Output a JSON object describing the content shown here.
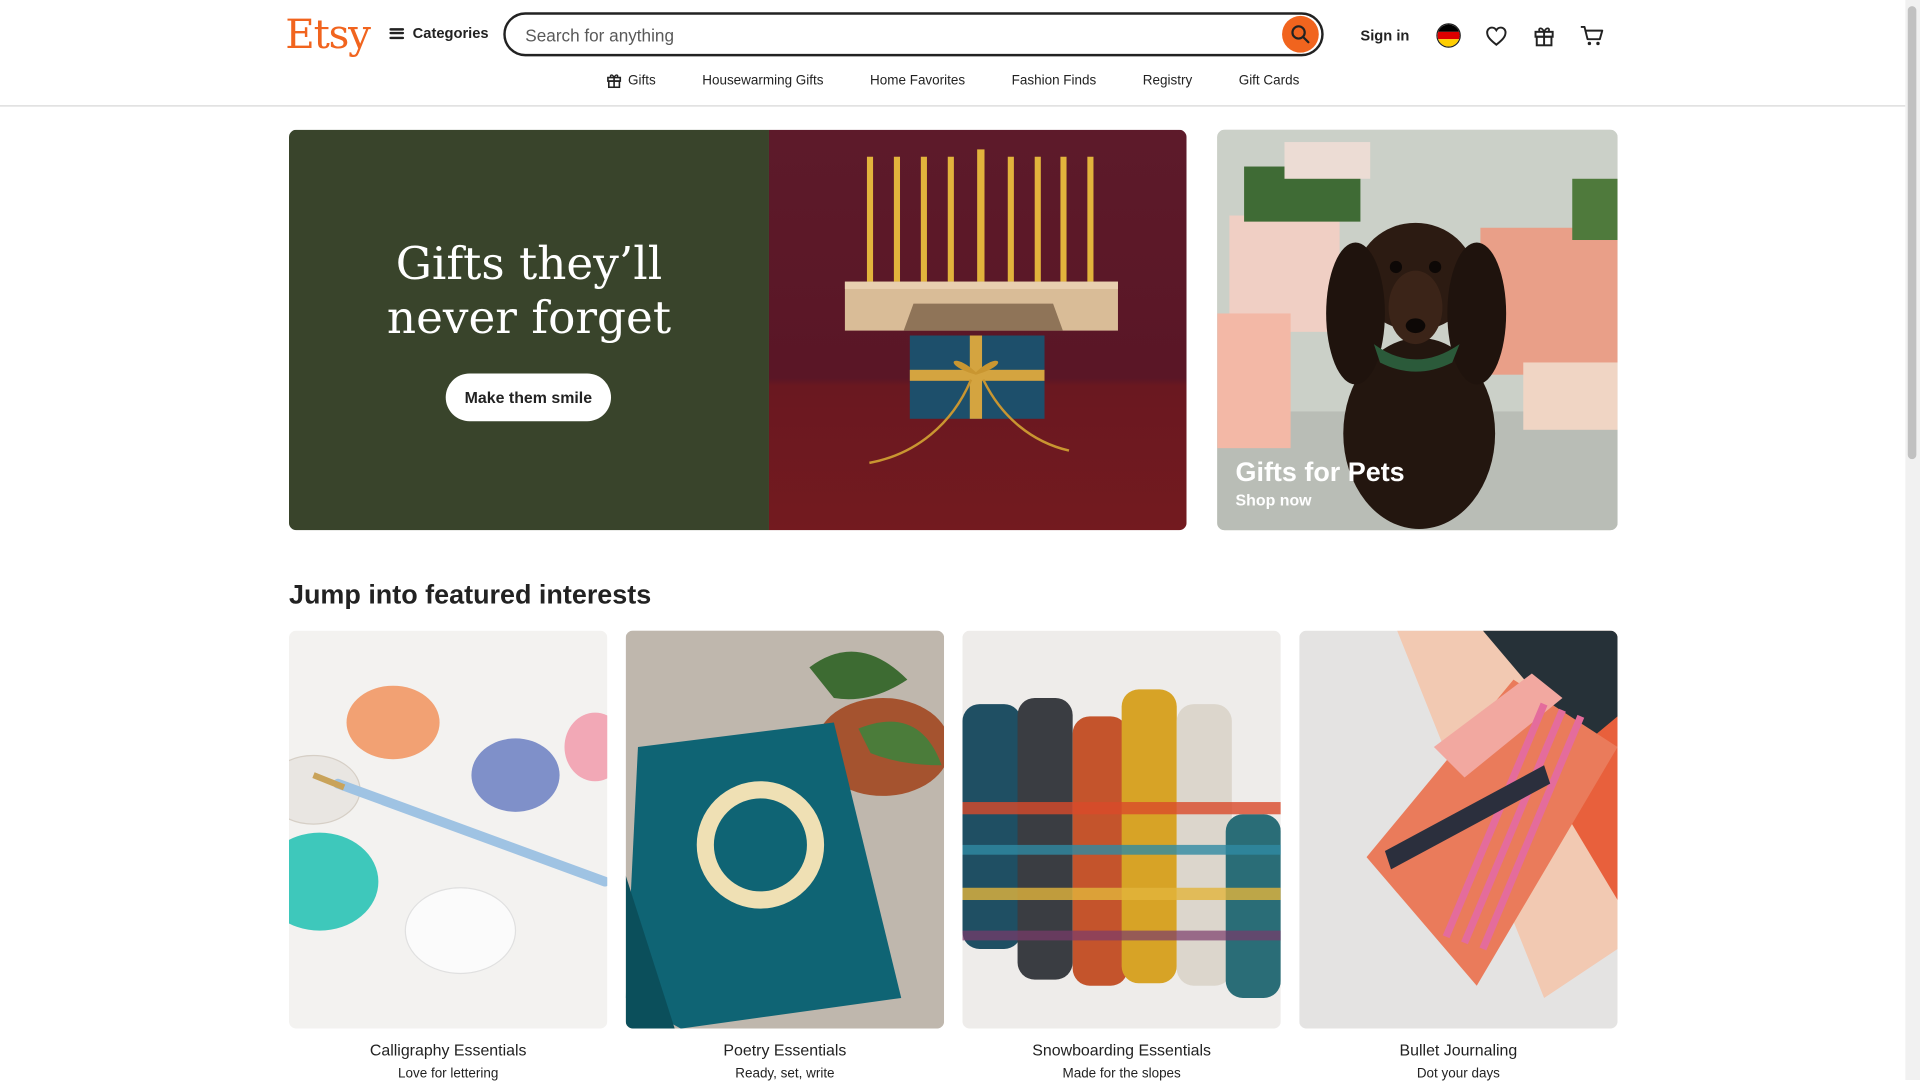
{
  "header": {
    "logo": "Etsy",
    "categories_label": "Categories",
    "search_placeholder": "Search for anything",
    "sign_in": "Sign in"
  },
  "subnav": {
    "items": [
      {
        "label": "Gifts",
        "icon": "gift-icon"
      },
      {
        "label": "Housewarming Gifts"
      },
      {
        "label": "Home Favorites"
      },
      {
        "label": "Fashion Finds"
      },
      {
        "label": "Registry"
      },
      {
        "label": "Gift Cards"
      }
    ]
  },
  "hero": {
    "title_line1": "Gifts they’ll",
    "title_line2": "never forget",
    "button": "Make them smile"
  },
  "pets_promo": {
    "title": "Gifts for Pets",
    "cta": "Shop now"
  },
  "featured": {
    "heading": "Jump into featured interests",
    "cards": [
      {
        "title": "Calligraphy Essentials",
        "subtitle": "Love for lettering"
      },
      {
        "title": "Poetry Essentials",
        "subtitle": "Ready, set, write"
      },
      {
        "title": "Snowboarding Essentials",
        "subtitle": "Made for the slopes"
      },
      {
        "title": "Bullet Journaling",
        "subtitle": "Dot your days"
      }
    ]
  },
  "colors": {
    "brand": "#f1641e",
    "hero_green": "#39442b",
    "hero_maroon": "#5d1a2a"
  },
  "icons": {
    "search": "search-icon",
    "locale": "germany-flag-icon",
    "favorites": "heart-icon",
    "gift_mode": "gift-icon",
    "cart": "cart-icon"
  }
}
